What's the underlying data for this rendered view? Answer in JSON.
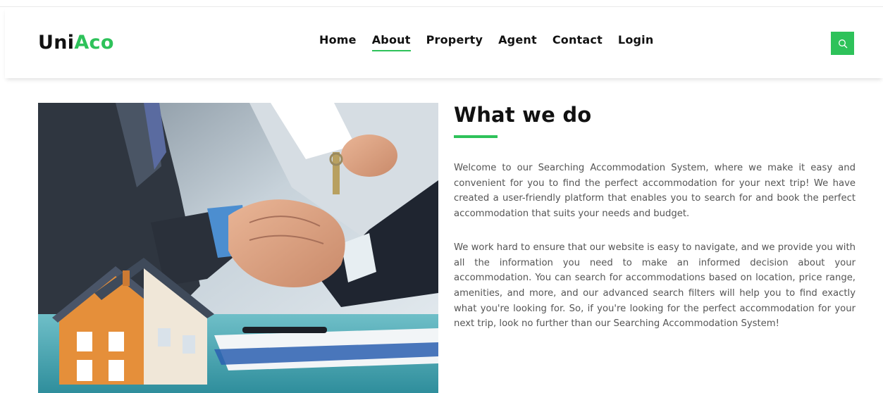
{
  "brand": {
    "part1": "Uni",
    "part2": "Aco",
    "accent_color": "#2ec25a"
  },
  "nav": {
    "items": [
      {
        "label": "Home",
        "active": false
      },
      {
        "label": "About",
        "active": true
      },
      {
        "label": "Property",
        "active": false
      },
      {
        "label": "Agent",
        "active": false
      },
      {
        "label": "Contact",
        "active": false
      },
      {
        "label": "Login",
        "active": false
      }
    ]
  },
  "search": {
    "icon": "search-icon"
  },
  "hero_image": {
    "subject": "handshake-with-keys-and-house-model"
  },
  "main": {
    "title": "What we do",
    "paragraph1": "Welcome to our Searching Accommodation System, where we make it easy and convenient for you to find the perfect accommodation for your next trip! We have created a user-friendly platform that enables you to search for and book the perfect accommodation that suits your needs and budget.",
    "paragraph2": "We work hard to ensure that our website is easy to navigate, and we provide you with all the information you need to make an informed decision about your accommodation. You can search for accommodations based on location, price range, amenities, and more, and our advanced search filters will help you to find exactly what you're looking for. So, if you're looking for the perfect accommodation for your next trip, look no further than our Searching Accommodation System!"
  }
}
